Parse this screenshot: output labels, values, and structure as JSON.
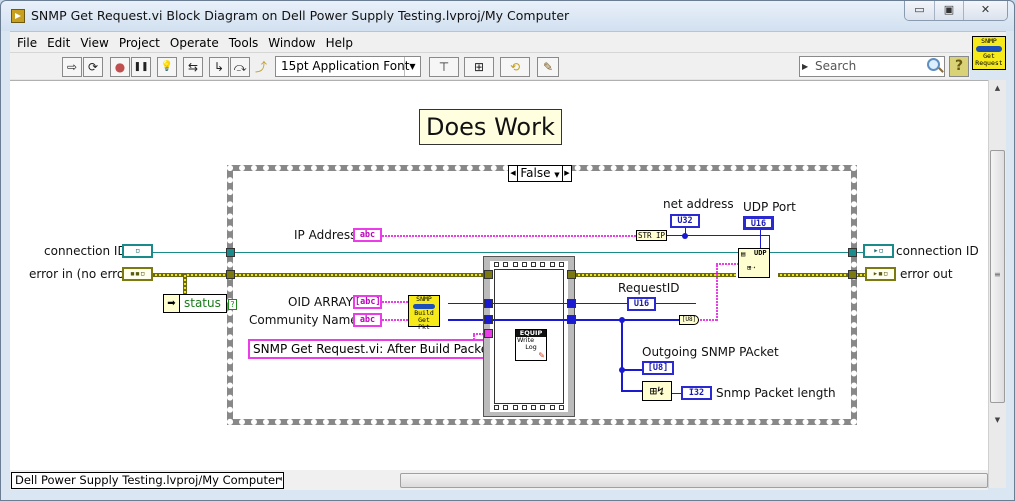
{
  "window": {
    "title": "SNMP Get Request.vi Block Diagram on Dell Power Supply Testing.lvproj/My Computer",
    "controls": {
      "minimize": "▭",
      "maximize": "▣",
      "close": "✕"
    }
  },
  "menu": [
    "File",
    "Edit",
    "View",
    "Project",
    "Operate",
    "Tools",
    "Window",
    "Help"
  ],
  "toolbar": {
    "run_icon": "⇨",
    "run_continuously_icon": "⟳",
    "abort_icon": "●",
    "pause_icon": "❚❚",
    "highlight_icon": "💡",
    "retain_wire_icon": "⇆",
    "step_into_icon": "↳",
    "step_over_icon": "⤼",
    "step_out_icon": "⤴",
    "font_select": "15pt Application Font",
    "align_icon": "⊤",
    "distribute_icon": "⊞",
    "reorder_icon": "⟲",
    "cleanup_icon": "✎",
    "search_placeholder": "Search",
    "help_icon": "?"
  },
  "vi_icon": {
    "line1": "SNMP",
    "line2": "Get",
    "line3": "Request"
  },
  "diagram": {
    "comment": "Does Work",
    "case_selector": "False",
    "labels": {
      "connection_id_in": "connection ID",
      "error_in": "error in (no error)",
      "status": "status",
      "ip_address": "IP Address",
      "oid_array": "OID ARRAY",
      "community_name": "Community Name",
      "log_message": "SNMP Get Request.vi: After Build Packet",
      "net_address": "net address",
      "udp_port": "UDP Port",
      "request_id": "RequestID",
      "outgoing_packet": "Outgoing SNMP PAcket",
      "packet_length": "Snmp Packet length",
      "connection_id_out": "connection ID",
      "error_out": "error out"
    },
    "terminals": {
      "abc": "abc",
      "abc_array": "[abc]",
      "u32": "U32",
      "u16": "U16",
      "u8_array": "[U8]",
      "i32": "I32",
      "str_ip": "STR IP",
      "u8_to_str": "[U8]"
    },
    "nodes": {
      "build_pkt": {
        "line1": "SNMP",
        "line2": "Build Get",
        "line3": "Pkt"
      },
      "write_log": {
        "line1": "EQUIP",
        "line2": "Write",
        "line3": "Log"
      },
      "udp": "UDP"
    }
  },
  "statusbar": {
    "path": "Dell Power Supply Testing.lvproj/My Computer"
  }
}
